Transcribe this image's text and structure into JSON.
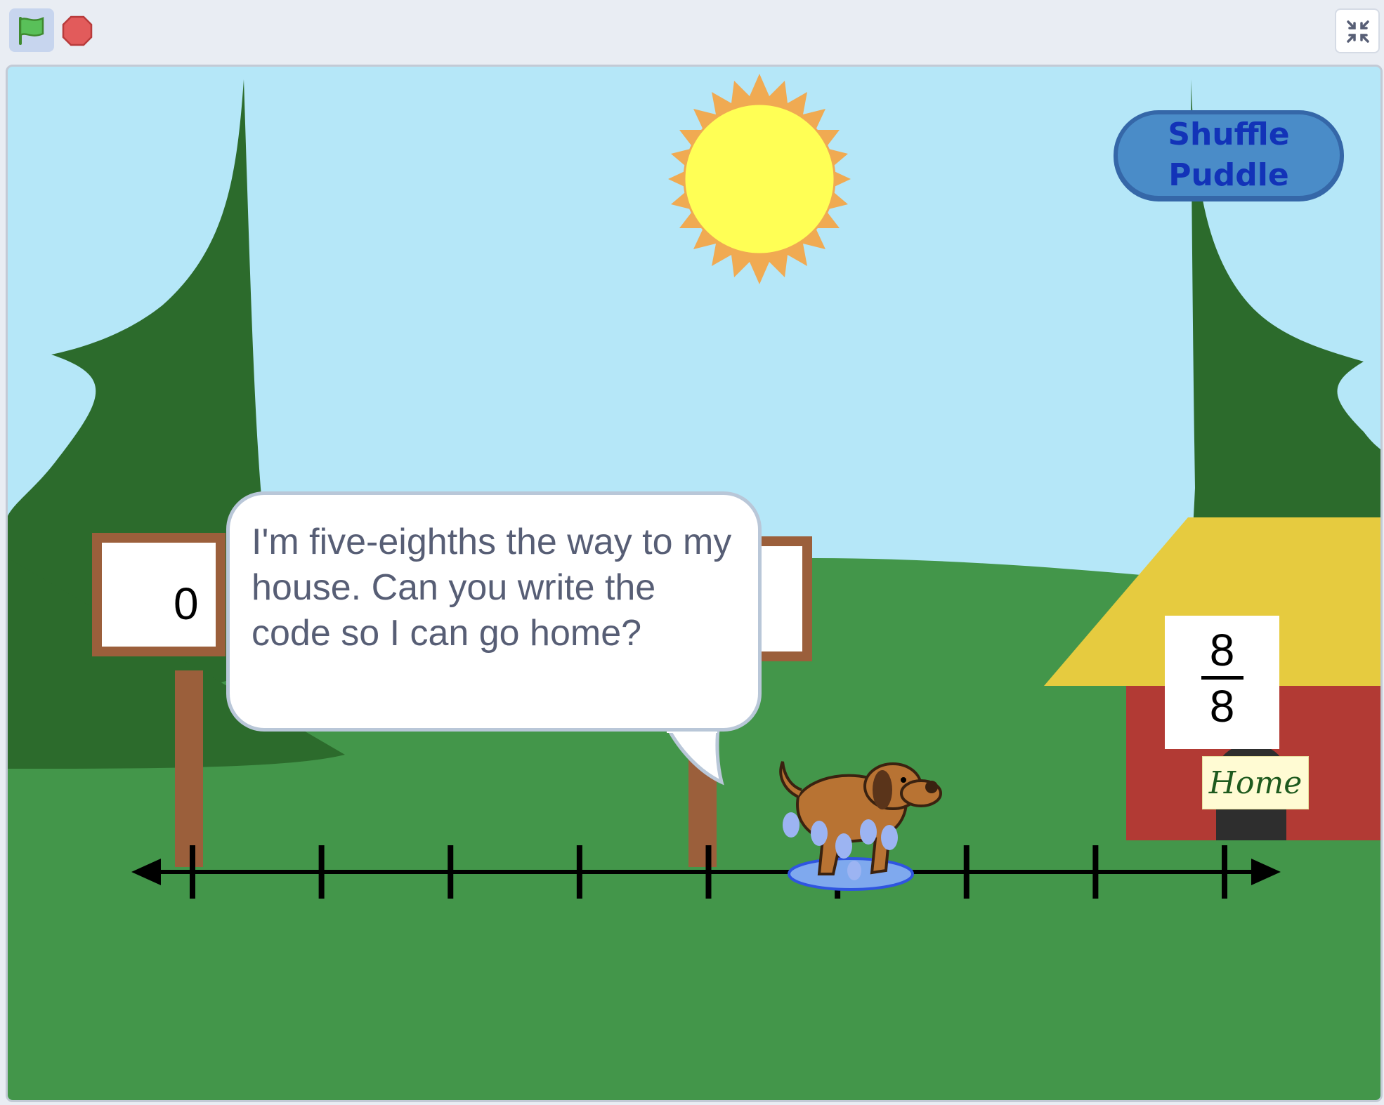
{
  "toolbar": {
    "green_flag_icon": "green-flag-icon",
    "stop_icon": "stop-sign-icon",
    "fullscreen_icon": "exit-fullscreen-icon"
  },
  "stage": {
    "shuffle_button": {
      "label": "Shuffle\nPuddle"
    },
    "left_sign": {
      "value": "0"
    },
    "speech_bubble": {
      "text": "I'm five-eighths the way to my house. Can you write the code so I can go home?"
    },
    "house": {
      "fraction": {
        "numerator": "8",
        "denominator": "8"
      },
      "home_label": "Home"
    },
    "number_line": {
      "tick_count": 9,
      "dog_position_eighths": 5
    }
  },
  "colors": {
    "sky": "#b5e7f8",
    "grass": "#43964a",
    "tree": "#2c6b2c",
    "sign_wood": "#9b5f3b",
    "house_wall": "#b23a34",
    "house_roof": "#e6cb3f",
    "shuffle_blue": "#4a8cc8",
    "shuffle_text": "#1233b8"
  }
}
